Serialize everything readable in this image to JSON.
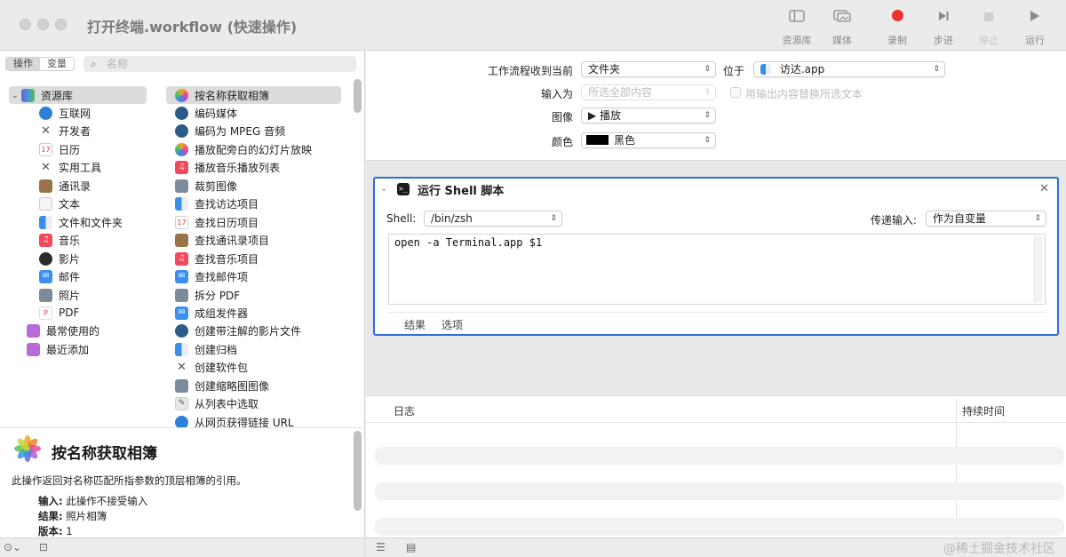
{
  "window": {
    "title": "打开终端.workflow (快速操作)"
  },
  "toolbar": {
    "library_label": "资源库",
    "media_label": "媒体",
    "record_label": "录制",
    "step_label": "步进",
    "stop_label": "停止",
    "run_label": "运行",
    "record_color": "#e8342c"
  },
  "left_panel": {
    "seg_actions": "操作",
    "seg_variables": "变量",
    "search_placeholder": "名称",
    "library": {
      "root_label": "资源库",
      "items": [
        "互联网",
        "开发者",
        "日历",
        "实用工具",
        "通讯录",
        "文本",
        "文件和文件夹",
        "音乐",
        "影片",
        "邮件",
        "照片",
        "PDF"
      ],
      "most_used": "最常使用的",
      "recently_added": "最近添加"
    },
    "actions": [
      "按名称获取相簿",
      "编码媒体",
      "编码为 MPEG 音频",
      "播放配旁白的幻灯片放映",
      "播放音乐播放列表",
      "裁剪图像",
      "查找访达项目",
      "查找日历项目",
      "查找通讯录项目",
      "查找音乐项目",
      "查找邮件项",
      "拆分 PDF",
      "成组发件器",
      "创建带注解的影片文件",
      "创建归档",
      "创建软件包",
      "创建缩略图图像",
      "从列表中选取",
      "从网页获得链接 URL"
    ],
    "description": {
      "title": "按名称获取相簿",
      "text": "此操作返回对名称匹配所指参数的顶层相簿的引用。",
      "input_key": "输入:",
      "input_val": "此操作不接受输入",
      "result_key": "结果:",
      "result_val": "照片相簿",
      "version_key": "版本:",
      "version_val": "1"
    }
  },
  "workflow": {
    "receives_label": "工作流程收到当前",
    "receives_value": "文件夹",
    "in_label": "位于",
    "in_value": "访达.app",
    "input_is_label": "输入为",
    "input_is_value": "所选全部内容",
    "replace_label": "用输出内容替换所选文本",
    "image_label": "图像",
    "image_value": "▶ 播放",
    "color_label": "颜色",
    "color_value": "黑色"
  },
  "action_card": {
    "title": "运行 Shell 脚本",
    "shell_label": "Shell:",
    "shell_value": "/bin/zsh",
    "pass_input_label": "传递输入:",
    "pass_input_value": "作为自变量",
    "script": "open -a Terminal.app $1",
    "tab_results": "结果",
    "tab_options": "选项"
  },
  "log": {
    "col_log": "日志",
    "col_duration": "持续时间"
  },
  "watermark": "@稀土掘金技术社区"
}
